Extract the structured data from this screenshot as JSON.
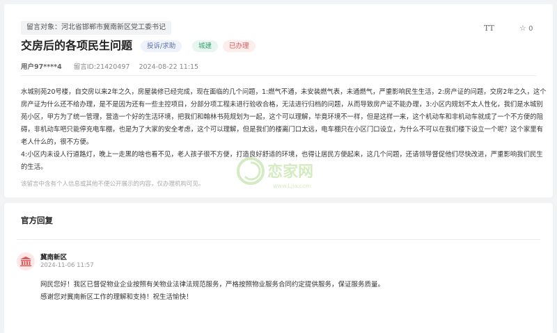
{
  "question": {
    "target_label": "留言对象：河北省邯郸市冀南新区党工委书记",
    "title": "交房后的各项民生问题",
    "tags": [
      "投诉/求助",
      "城建",
      "已办理"
    ],
    "user": "用户97****4",
    "message_id": "留言ID:21420497",
    "date": "2024-08-22 11:15",
    "font_toggle": "TT",
    "favorite_count": "0",
    "paragraphs": [
      "水城别苑20号楼，自交房以来2年之久，房屋装修已经完成，现在面临的几个问题，1:燃气不通，未安装燃气表，未通燃气，严重影响民生生活，2:房产证的问题，交房2年之久，这个房产证为什么还不给办理，是不是因为还有一些主控项目，分部分项工程未进行验收合格，无法进行归档的问题，从而导致房产证不能办理，3:小区内规划不太人性化，我们是水城别苑小区，甲方为了统一管理，营造一个好的生活环境，把我们和翰林书苑规划为一起，这个可以理解，毕竟环境不一样，但是这样一来，这个机动车和非机动车就成了一个不方便的阻碍，非机动车吧只能停充电车棚，也是为了大家的安全考虑，这个可以理解，但是我们的楼离门口太远，电车棚只在小区门口设立，为什么不可以在我们楼下设立一个呢？这个家里有老人什么的，很不方便。",
      "4:小区内未设人行道路灯，晚上一走黑的啥也看不见，老人孩子很不方便，打造良好舒适的环境，也得让居民方便起来，这几个问题，还请领导督促他们尽快改进，严重影响我们民生的生活。"
    ],
    "privacy_notice": "该留言中含有个人信息或其他不便公开展示的内容，仅办理机构可见。"
  },
  "reply": {
    "section_title": "官方回复",
    "department": "冀南新区",
    "time": "2024-11-06 11:57",
    "lines": [
      "网民您好！我区已督促物业企业按照有关物业法律法规范服务，严格按照物业服务合同约定提供服务，保证服务质量。",
      "感谢您对冀南新区工作的理解和支持！祝生活愉快！"
    ]
  },
  "watermark": {
    "text": "恋家网",
    "url": "www.Ljia.com"
  },
  "colors": {
    "tag_complaint": "#5a72a8",
    "tag_city": "#34a36e",
    "tag_done": "#e05555",
    "watermark": "#7cc242"
  }
}
